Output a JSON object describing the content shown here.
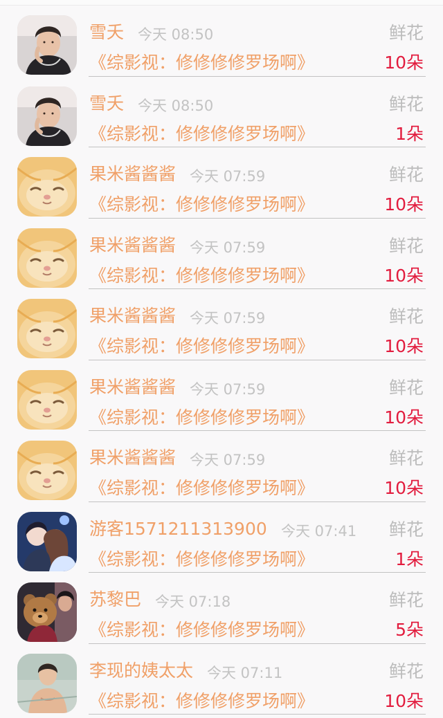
{
  "rows": [
    {
      "name": "雪夭",
      "time": "今天 08:50",
      "gift": "鲜花",
      "book": "《综影视：修修修修罗场啊》",
      "count": "10朵",
      "avatar": "man-avatar"
    },
    {
      "name": "雪夭",
      "time": "今天 08:50",
      "gift": "鲜花",
      "book": "《综影视：修修修修罗场啊》",
      "count": "1朵",
      "avatar": "man-avatar"
    },
    {
      "name": "果米酱酱酱",
      "time": "今天 07:59",
      "gift": "鲜花",
      "book": "《综影视：修修修修罗场啊》",
      "count": "10朵",
      "avatar": "kitten-avatar"
    },
    {
      "name": "果米酱酱酱",
      "time": "今天 07:59",
      "gift": "鲜花",
      "book": "《综影视：修修修修罗场啊》",
      "count": "10朵",
      "avatar": "kitten-avatar"
    },
    {
      "name": "果米酱酱酱",
      "time": "今天 07:59",
      "gift": "鲜花",
      "book": "《综影视：修修修修罗场啊》",
      "count": "10朵",
      "avatar": "kitten-avatar"
    },
    {
      "name": "果米酱酱酱",
      "time": "今天 07:59",
      "gift": "鲜花",
      "book": "《综影视：修修修修罗场啊》",
      "count": "10朵",
      "avatar": "kitten-avatar"
    },
    {
      "name": "果米酱酱酱",
      "time": "今天 07:59",
      "gift": "鲜花",
      "book": "《综影视：修修修修罗场啊》",
      "count": "10朵",
      "avatar": "kitten-avatar"
    },
    {
      "name": "游客1571211313900",
      "time": "今天 07:41",
      "gift": "鲜花",
      "book": "《综影视：修修修修罗场啊》",
      "count": "1朵",
      "avatar": "anime-couple-avatar"
    },
    {
      "name": "苏黎巴",
      "time": "今天 07:18",
      "gift": "鲜花",
      "book": "《综影视：修修修修罗场啊》",
      "count": "5朵",
      "avatar": "teddy-bear-avatar"
    },
    {
      "name": "李现的姨太太",
      "time": "今天 07:11",
      "gift": "鲜花",
      "book": "《综影视：修修修修罗场啊》",
      "count": "10朵",
      "avatar": "shirtless-man-avatar"
    }
  ],
  "colors": {
    "name": "#f0a068",
    "time": "#c3c3c3",
    "gift": "#bcbcbc",
    "count": "#e21c3e",
    "divider": "#c2c2c2",
    "background": "#f9f8f9"
  }
}
